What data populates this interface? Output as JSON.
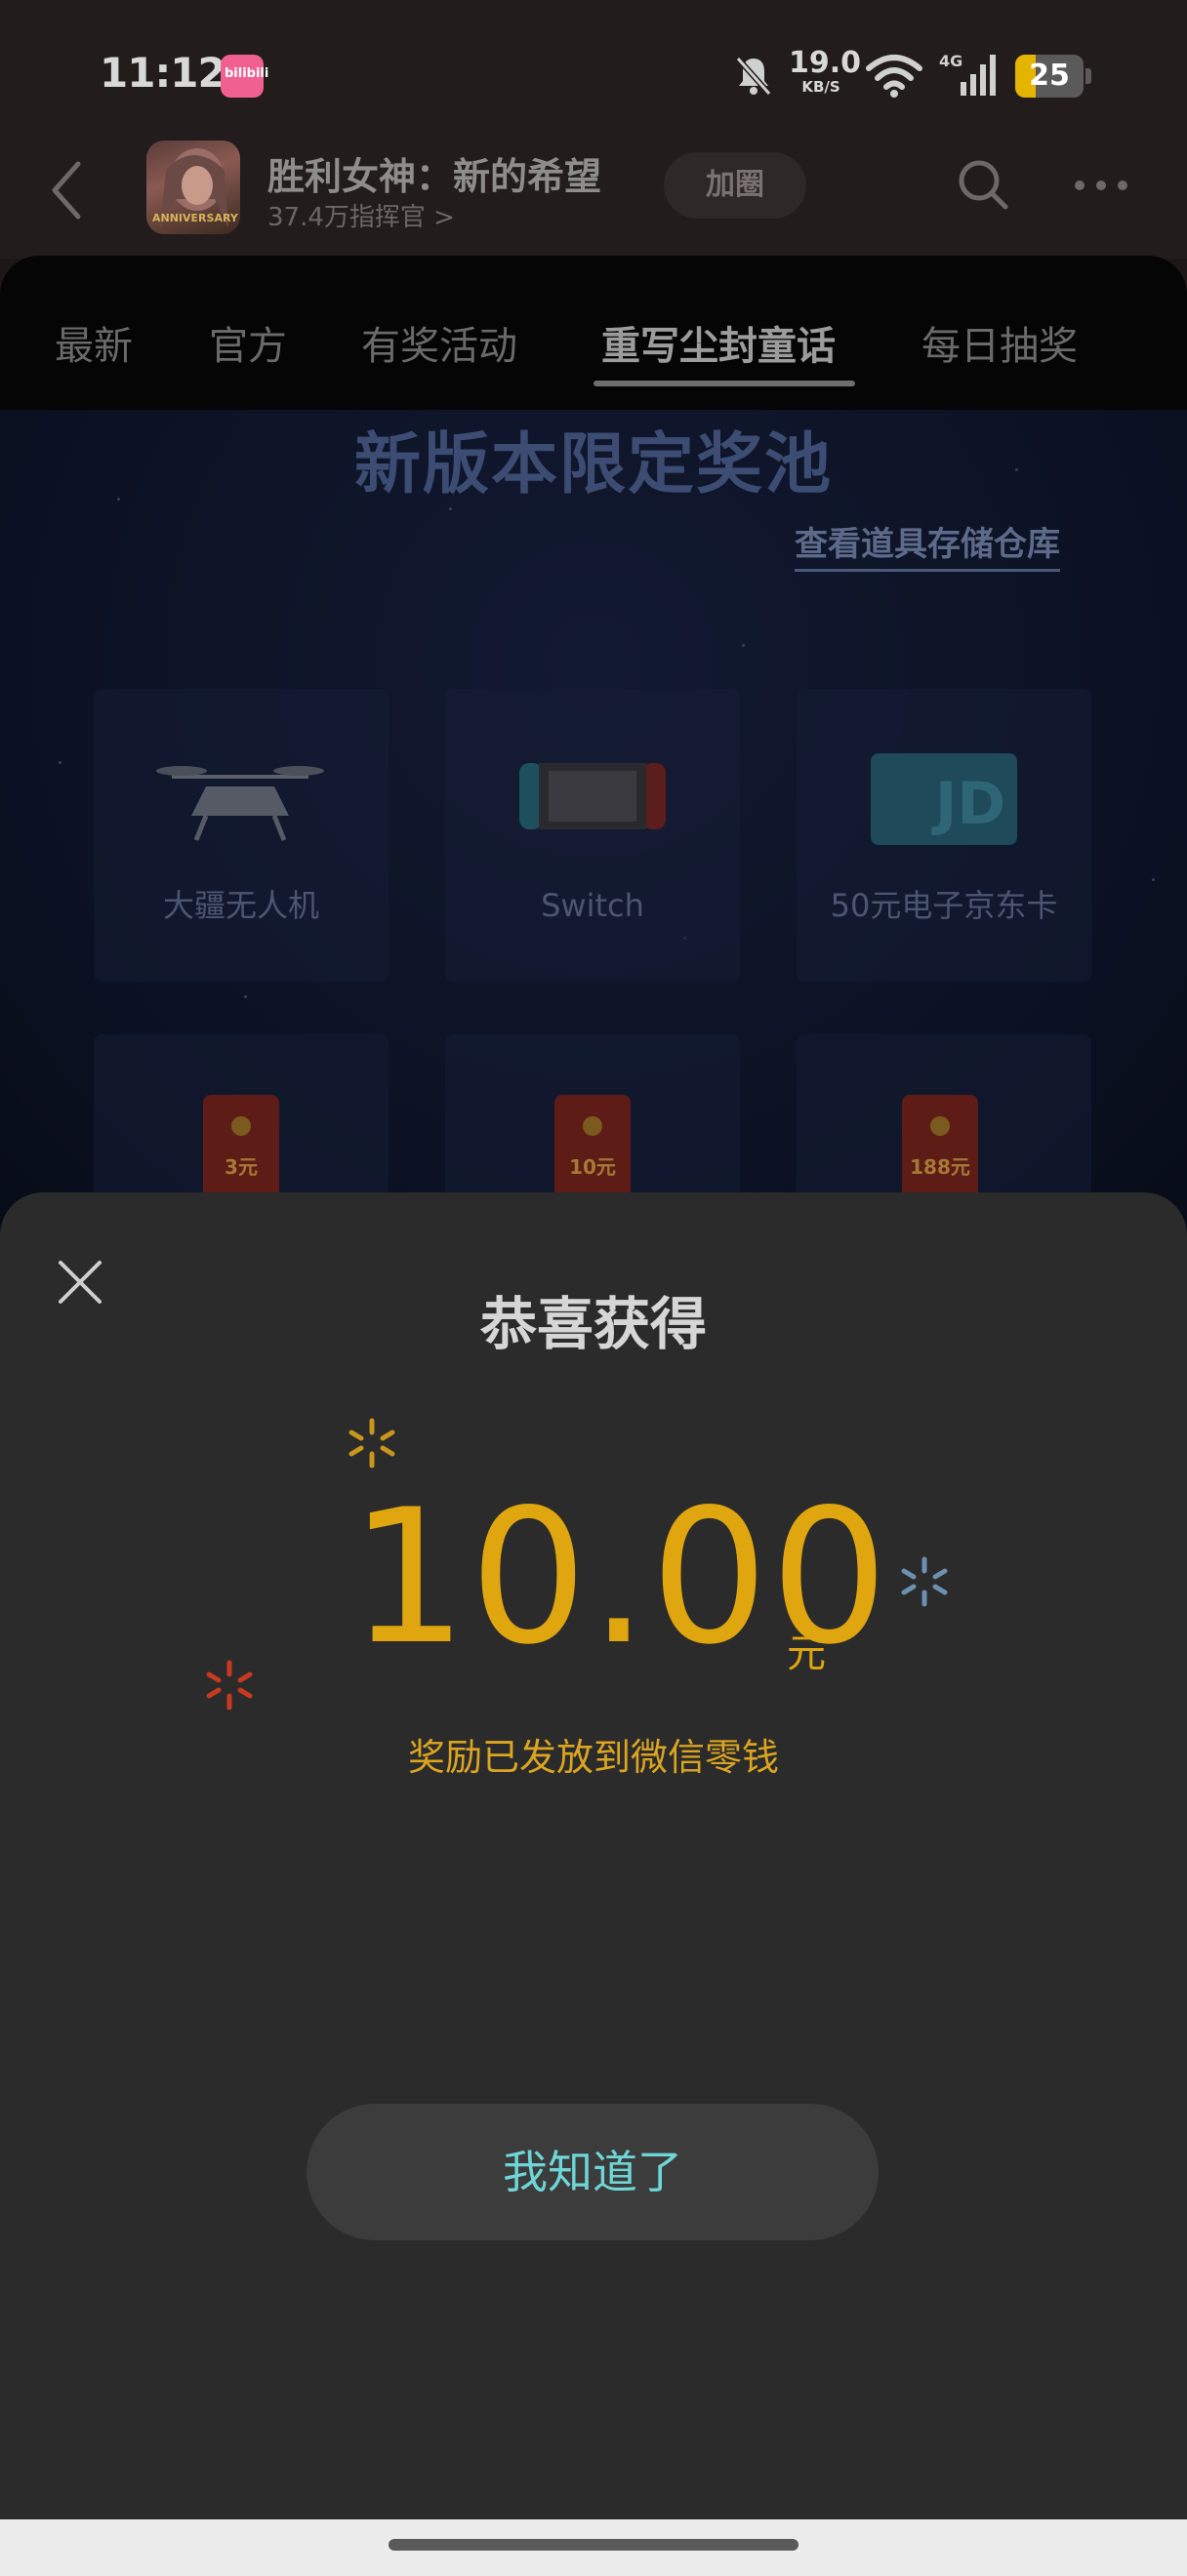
{
  "status_bar": {
    "time": "11:12",
    "app_badge": "bilibili",
    "net_speed_value": "19.0",
    "net_speed_unit": "KB/S",
    "network_type": "4G",
    "battery": "25"
  },
  "header": {
    "title": "胜利女神：新的希望",
    "subtitle": "37.4万指挥官 >",
    "avatar_badge": "ANNIVERSARY",
    "join_label": "加圈"
  },
  "tabs": [
    {
      "label": "最新"
    },
    {
      "label": "官方"
    },
    {
      "label": "有奖活动"
    },
    {
      "label": "重写尘封童话",
      "active": true
    },
    {
      "label": "每日抽奖"
    }
  ],
  "content": {
    "pool_title": "新版本限定奖池",
    "warehouse_link": "查看道具存储仓库",
    "prizes": [
      {
        "label": "大疆无人机",
        "icon": "drone-icon"
      },
      {
        "label": "Switch",
        "icon": "switch-console-icon"
      },
      {
        "label": "50元电子京东卡",
        "icon": "jd-card-icon"
      }
    ],
    "red_packets": [
      "3元",
      "10元",
      "188元"
    ]
  },
  "modal": {
    "title": "恭喜获得",
    "amount": "10.00",
    "unit": "元",
    "note": "奖励已发放到微信零钱",
    "confirm_label": "我知道了"
  },
  "colors": {
    "amount": "#e0a60f",
    "confirm_text": "#6fd6d8",
    "modal_bg": "#2b2b2b",
    "spark_gold": "#c9961d",
    "spark_blue": "#6d8fb0",
    "spark_red": "#c8391f"
  }
}
